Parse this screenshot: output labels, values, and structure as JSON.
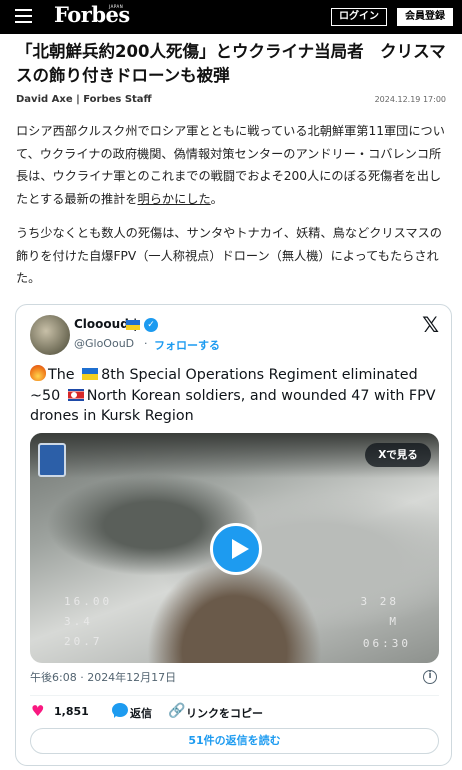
{
  "header": {
    "brand": "Forbes",
    "brand_sub": "JAPAN",
    "login_label": "ログイン",
    "register_label": "会員登録"
  },
  "article": {
    "headline": "「北朝鮮兵約200人死傷」とウクライナ当局者　クリスマスの飾り付きドローンも被弾",
    "author": "David Axe | Forbes Staff",
    "date": "2024.12.19 17:00",
    "p1_text": "ロシア西部クルスク州でロシア軍とともに戦っている北朝鮮軍第11軍団について、ウクライナの政府機関、偽情報対策センターのアンドリー・コバレンコ所長は、ウクライナ軍とのこれまでの戦闘でおよそ200人にのぼる死傷者を出したとする最新の推計を",
    "p1_link": "明らかにした",
    "p1_end": "。",
    "p2_text": "うち少なくとも数人の死傷は、サンタやトナカイ、妖精、鳥などクリスマスの飾りを付けた自爆FPV（一人称視点）ドローン（無人機）によってもたらされた。"
  },
  "tweet": {
    "name": "Cloooud |",
    "handle": "@GloOouD",
    "dot": "·",
    "follow_label": "フォローする",
    "text_part1": "The ",
    "text_part2": "8th Special Operations Regiment eliminated ~50 ",
    "text_part3": "North Korean soldiers, and wounded 47 with FPV drones in Kursk Region",
    "view_on_x_label": "Xで見る",
    "osd": {
      "l1": "16.00",
      "l2": "3.4",
      "l3": "20.7",
      "r1": "3 28",
      "r2": "M",
      "r3": "06:30"
    },
    "timestamp": "午後6:08 · 2024年12月17日",
    "like_count": "1,851",
    "reply_label": "返信",
    "copy_link_label": "リンクをコピー",
    "read_replies_label": "51件の返信を読む"
  },
  "colors": {
    "header_bg": "#000000",
    "accent_blue": "#1d9bf0",
    "like_pink": "#f91880"
  },
  "icons": [
    "menu-icon",
    "verified-icon",
    "x-logo-icon",
    "play-icon",
    "info-icon",
    "heart-icon",
    "reply-icon",
    "link-icon",
    "fire-emoji",
    "ukraine-flag-emoji",
    "north-korea-flag-emoji"
  ]
}
